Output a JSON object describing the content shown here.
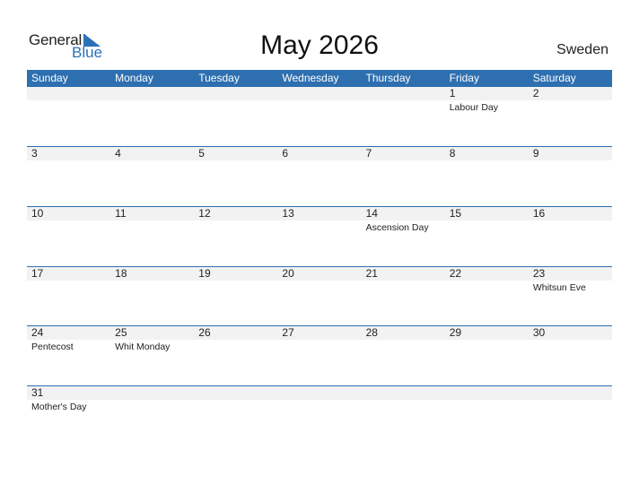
{
  "brand": {
    "word1": "General",
    "word2": "Blue",
    "accent": "#2e6fb0"
  },
  "title": "May 2026",
  "country": "Sweden",
  "weekdays": [
    "Sunday",
    "Monday",
    "Tuesday",
    "Wednesday",
    "Thursday",
    "Friday",
    "Saturday"
  ],
  "weeks": [
    [
      {
        "day": "",
        "holiday": ""
      },
      {
        "day": "",
        "holiday": ""
      },
      {
        "day": "",
        "holiday": ""
      },
      {
        "day": "",
        "holiday": ""
      },
      {
        "day": "",
        "holiday": ""
      },
      {
        "day": "1",
        "holiday": "Labour Day"
      },
      {
        "day": "2",
        "holiday": ""
      }
    ],
    [
      {
        "day": "3",
        "holiday": ""
      },
      {
        "day": "4",
        "holiday": ""
      },
      {
        "day": "5",
        "holiday": ""
      },
      {
        "day": "6",
        "holiday": ""
      },
      {
        "day": "7",
        "holiday": ""
      },
      {
        "day": "8",
        "holiday": ""
      },
      {
        "day": "9",
        "holiday": ""
      }
    ],
    [
      {
        "day": "10",
        "holiday": ""
      },
      {
        "day": "11",
        "holiday": ""
      },
      {
        "day": "12",
        "holiday": ""
      },
      {
        "day": "13",
        "holiday": ""
      },
      {
        "day": "14",
        "holiday": "Ascension Day"
      },
      {
        "day": "15",
        "holiday": ""
      },
      {
        "day": "16",
        "holiday": ""
      }
    ],
    [
      {
        "day": "17",
        "holiday": ""
      },
      {
        "day": "18",
        "holiday": ""
      },
      {
        "day": "19",
        "holiday": ""
      },
      {
        "day": "20",
        "holiday": ""
      },
      {
        "day": "21",
        "holiday": ""
      },
      {
        "day": "22",
        "holiday": ""
      },
      {
        "day": "23",
        "holiday": "Whitsun Eve"
      }
    ],
    [
      {
        "day": "24",
        "holiday": "Pentecost"
      },
      {
        "day": "25",
        "holiday": "Whit Monday"
      },
      {
        "day": "26",
        "holiday": ""
      },
      {
        "day": "27",
        "holiday": ""
      },
      {
        "day": "28",
        "holiday": ""
      },
      {
        "day": "29",
        "holiday": ""
      },
      {
        "day": "30",
        "holiday": ""
      }
    ],
    [
      {
        "day": "31",
        "holiday": "Mother's Day"
      },
      {
        "day": "",
        "holiday": ""
      },
      {
        "day": "",
        "holiday": ""
      },
      {
        "day": "",
        "holiday": ""
      },
      {
        "day": "",
        "holiday": ""
      },
      {
        "day": "",
        "holiday": ""
      },
      {
        "day": "",
        "holiday": ""
      }
    ]
  ]
}
